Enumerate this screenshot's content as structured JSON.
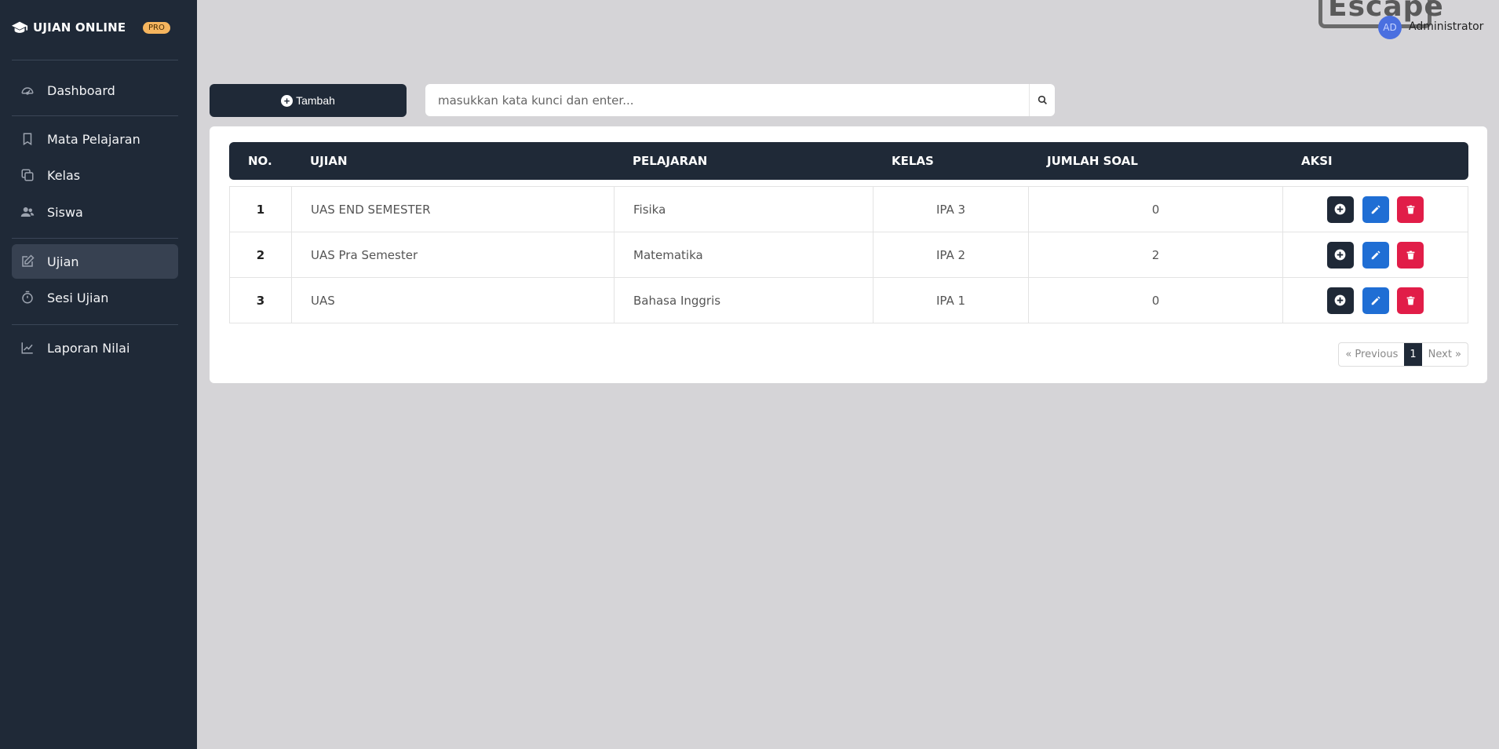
{
  "brand": {
    "title": "UJIAN ONLINE",
    "badge": "PRO"
  },
  "sidebar": {
    "items": [
      {
        "label": "Dashboard",
        "icon": "dashboard-gauge-icon"
      },
      {
        "label": "Mata Pelajaran",
        "icon": "bookmark-icon"
      },
      {
        "label": "Kelas",
        "icon": "copy-icon"
      },
      {
        "label": "Siswa",
        "icon": "users-icon"
      },
      {
        "label": "Ujian",
        "icon": "edit-icon",
        "active": true
      },
      {
        "label": "Sesi Ujian",
        "icon": "stopwatch-icon"
      },
      {
        "label": "Laporan Nilai",
        "icon": "chart-line-icon"
      }
    ]
  },
  "header": {
    "overlay_text": "Escape",
    "avatar_initials": "AD",
    "user_name": "Administrator"
  },
  "toolbar": {
    "add_label": "Tambah",
    "search_placeholder": "masukkan kata kunci dan enter..."
  },
  "table": {
    "headers": [
      "NO.",
      "UJIAN",
      "PELAJARAN",
      "KELAS",
      "JUMLAH SOAL",
      "AKSI"
    ],
    "rows": [
      {
        "no": "1",
        "ujian": "UAS END SEMESTER",
        "pelajaran": "Fisika",
        "kelas": "IPA 3",
        "jumlah": "0"
      },
      {
        "no": "2",
        "ujian": "UAS Pra Semester",
        "pelajaran": "Matematika",
        "kelas": "IPA 2",
        "jumlah": "2"
      },
      {
        "no": "3",
        "ujian": "UAS",
        "pelajaran": "Bahasa Inggris",
        "kelas": "IPA 1",
        "jumlah": "0"
      }
    ]
  },
  "pagination": {
    "previous": "« Previous",
    "current": "1",
    "next": "Next »"
  },
  "colors": {
    "sidebar": "#1f2937",
    "primary": "#1f6ed4",
    "danger": "#e11d48",
    "badge": "#f6b55e"
  }
}
